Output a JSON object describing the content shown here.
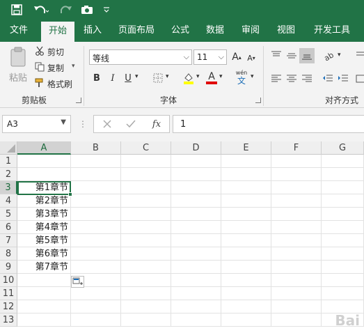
{
  "quick_access": {
    "icons": [
      "save-icon",
      "undo-icon",
      "redo-icon",
      "camera-icon",
      "customize-icon"
    ]
  },
  "tabs": [
    {
      "label": "文件"
    },
    {
      "label": "开始"
    },
    {
      "label": "插入"
    },
    {
      "label": "页面布局"
    },
    {
      "label": "公式"
    },
    {
      "label": "数据"
    },
    {
      "label": "审阅"
    },
    {
      "label": "视图"
    },
    {
      "label": "开发工具"
    }
  ],
  "active_tab": "开始",
  "ribbon": {
    "clipboard": {
      "paste_label": "粘贴",
      "cut_label": "剪切",
      "copy_label": "复制",
      "format_painter_label": "格式刷",
      "group_label": "剪贴板"
    },
    "font": {
      "font_name": "等线",
      "font_size": "11",
      "bold": "B",
      "italic": "I",
      "underline": "U",
      "wen": "wén",
      "wen_char": "文",
      "group_label": "字体"
    },
    "alignment": {
      "group_label": "对齐方式"
    }
  },
  "formula_bar": {
    "name_box": "A3",
    "fx_label": "fx",
    "value": "1"
  },
  "grid": {
    "columns": [
      "A",
      "B",
      "C",
      "D",
      "E",
      "F",
      "G"
    ],
    "rows": [
      "1",
      "2",
      "3",
      "4",
      "5",
      "6",
      "7",
      "8",
      "9",
      "10",
      "11",
      "12",
      "13"
    ],
    "cells_A": [
      "",
      "",
      "第1章节",
      "第2章节",
      "第3章节",
      "第4章节",
      "第5章节",
      "第6章节",
      "第7章节",
      "",
      "",
      "",
      ""
    ],
    "active_cell": "A3"
  },
  "colors": {
    "accent": "#217346",
    "ribbon_bg": "#f3f3f3",
    "font_color_bar": "#e00000",
    "highlight_bar": "#ffff00"
  },
  "watermark": "Bai"
}
